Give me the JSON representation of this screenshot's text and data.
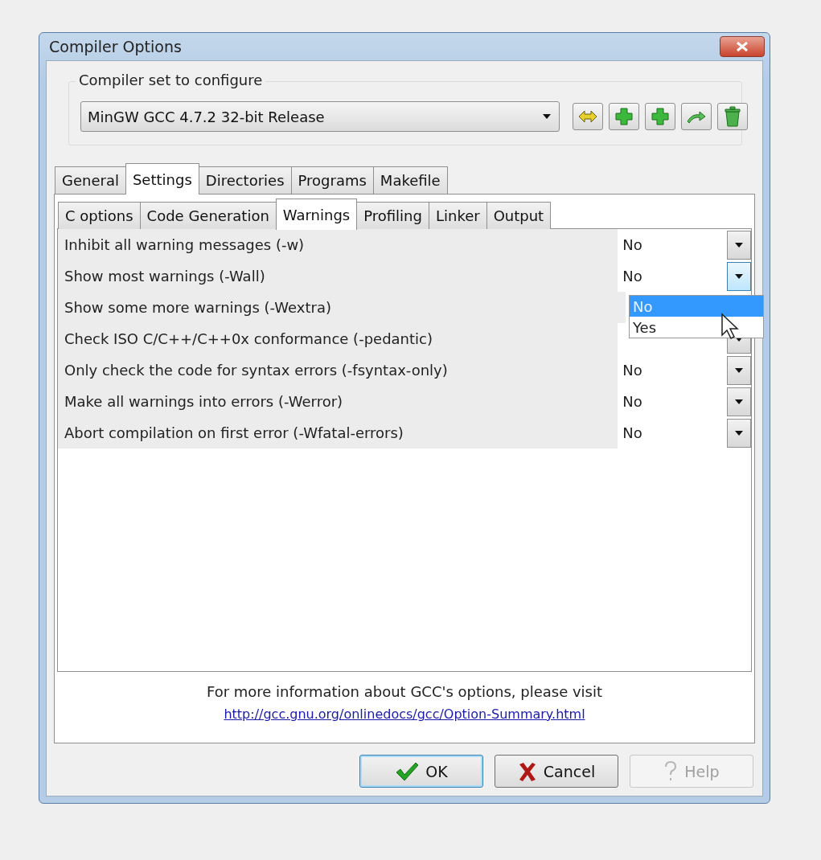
{
  "window": {
    "title": "Compiler Options"
  },
  "compiler_set": {
    "label": "Compiler set to configure",
    "value": "MinGW GCC 4.7.2 32-bit Release"
  },
  "tabs": [
    {
      "label": "General",
      "selected": false
    },
    {
      "label": "Settings",
      "selected": true
    },
    {
      "label": "Directories",
      "selected": false
    },
    {
      "label": "Programs",
      "selected": false
    },
    {
      "label": "Makefile",
      "selected": false
    }
  ],
  "subtabs": [
    {
      "label": "C options",
      "selected": false
    },
    {
      "label": "Code Generation",
      "selected": false
    },
    {
      "label": "Warnings",
      "selected": true
    },
    {
      "label": "Profiling",
      "selected": false
    },
    {
      "label": "Linker",
      "selected": false
    },
    {
      "label": "Output",
      "selected": false
    }
  ],
  "options": [
    {
      "label": "Inhibit all warning messages (-w)",
      "value": "No",
      "focused": false
    },
    {
      "label": "Show most warnings (-Wall)",
      "value": "No",
      "focused": true,
      "dropdown": [
        {
          "label": "No",
          "selected": true
        },
        {
          "label": "Yes",
          "selected": false
        }
      ]
    },
    {
      "label": "Show some more warnings (-Wextra)"
    },
    {
      "label": "Check ISO C/C++/C++0x conformance (-pedantic)"
    },
    {
      "label": "Only check the code for syntax errors (-fsyntax-only)",
      "value": "No",
      "focused": false
    },
    {
      "label": "Make all warnings into errors (-Werror)",
      "value": "No",
      "focused": false
    },
    {
      "label": "Abort compilation on first error (-Wfatal-errors)",
      "value": "No",
      "focused": false
    }
  ],
  "info": {
    "text": "For more information about GCC's options, please visit",
    "link": "http://gcc.gnu.org/onlinedocs/gcc/Option-Summary.html"
  },
  "buttons": [
    {
      "kind": "ok",
      "label": "OK",
      "disabled": false,
      "focused": true
    },
    {
      "kind": "cancel",
      "label": "Cancel",
      "disabled": false,
      "focused": false
    },
    {
      "kind": "help",
      "label": "Help",
      "disabled": true,
      "focused": false
    }
  ]
}
